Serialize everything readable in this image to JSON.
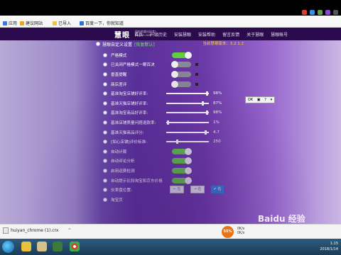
{
  "chrome": {
    "bookmarks": [
      {
        "label": "应用",
        "color": "#3b78e7"
      },
      {
        "label": "建议网站",
        "color": "#f0a21a"
      },
      {
        "label": "已导入",
        "color": "#f0c24a"
      },
      {
        "label": "百度一下，你就知道",
        "color": "#2b6fd8"
      }
    ]
  },
  "site": {
    "logo": "慧眼",
    "logo_sub": "轻松的量出好卖！huiyan.com",
    "nav": [
      "首页",
      "升级历史",
      "安装慧眼",
      "安装帮助",
      "留言反馈",
      "关于慧眼",
      "慧眼帐号"
    ]
  },
  "panel": {
    "title": "慧眼自定义设置",
    "restore": "[恢复默认]",
    "version": "当前慧眼版本：3.2.1.2"
  },
  "toggles": [
    {
      "label": "严格模式",
      "on": true
    },
    {
      "label": "已关闭严格模式一眼百决",
      "on": false
    },
    {
      "label": "垂直提醒",
      "on": false
    },
    {
      "label": "商店差评",
      "on": false
    }
  ],
  "sliders": [
    {
      "label": "基准淘宝店铺好评率:",
      "value": "98%",
      "pct": 0.98
    },
    {
      "label": "基准天猫店铺好评率:",
      "value": "87%",
      "pct": 0.87
    },
    {
      "label": "基准淘宝商品好评率:",
      "value": "98%",
      "pct": 0.98
    },
    {
      "label": "基准店铺质量问题退款率:",
      "value": "1%",
      "pct": 0.01
    },
    {
      "label": "基准天猫商品评分:",
      "value": "4.7",
      "pct": 0.94
    },
    {
      "label": "[如心店铺]评价标准:",
      "value": "250",
      "pct": 0.25
    }
  ],
  "toggles2": [
    {
      "label": "自动计算",
      "on": true
    },
    {
      "label": "自动评论分析",
      "on": true
    },
    {
      "label": "启用运费检测",
      "on": true
    },
    {
      "label": "自动提示比较淘宝和京东价格",
      "on": true
    }
  ],
  "position": {
    "label": "仪表盘位置:",
    "left": "← 左",
    "right": "→ 右",
    "confirm": "✔ 右"
  },
  "cut_row": {
    "label": "淘宝页"
  },
  "toolbox": [
    "OK",
    "▣",
    "?",
    "▾"
  ],
  "download": {
    "file": "huiyan_chrome (1).crx",
    "caret": "^"
  },
  "monitor": {
    "percent": "55%",
    "up": "0K/s",
    "down": "0K/s"
  },
  "tray": {
    "time": "1:15",
    "date": "2018/1/14"
  },
  "watermark": "Baidu 经验"
}
